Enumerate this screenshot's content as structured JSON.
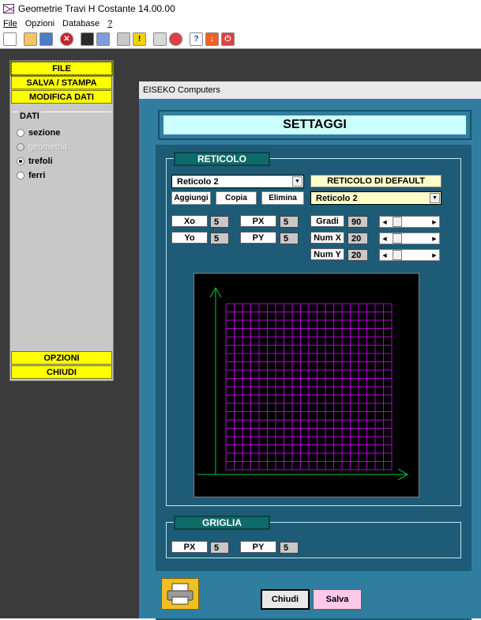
{
  "window": {
    "title": "Geometrie Travi H Costante  14.00.00"
  },
  "menubar": {
    "items": [
      "File",
      "Opzioni",
      "Database",
      "?"
    ]
  },
  "sidebar": {
    "file_btn": "FILE",
    "salva_btn": "SALVA / STAMPA",
    "modifica_btn": "MODIFICA DATI",
    "dati_label": "DATI",
    "radios": [
      {
        "label": "sezione",
        "selected": false,
        "enabled": true
      },
      {
        "label": "geometria",
        "selected": false,
        "enabled": false
      },
      {
        "label": "trefoli",
        "selected": true,
        "enabled": true
      },
      {
        "label": "ferri",
        "selected": false,
        "enabled": true
      }
    ],
    "opzioni_btn": "OPZIONI",
    "chiudi_btn": "CHIUDI"
  },
  "dialog": {
    "title": "EISEKO Computers",
    "header": "SETTAGGI",
    "reticolo": {
      "tab_label": "RETICOLO",
      "selected_reticolo": "Reticolo 2",
      "buttons": {
        "aggiungi": "Aggiungi",
        "copia": "Copia",
        "elimina": "Elimina"
      },
      "default_header": "RETICOLO DI DEFAULT",
      "default_value": "Reticolo 2",
      "xo_label": "Xo",
      "xo_value": "5",
      "yo_label": "Yo",
      "yo_value": "5",
      "px_label": "PX",
      "px_value": "5",
      "py_label": "PY",
      "py_value": "5",
      "gradi_label": "Gradi",
      "gradi_value": "90",
      "numx_label": "Num X",
      "numx_value": "20",
      "numy_label": "Num Y",
      "numy_value": "20"
    },
    "griglia": {
      "tab_label": "GRIGLIA",
      "px_label": "PX",
      "px_value": "5",
      "py_label": "PY",
      "py_value": "5"
    },
    "chiudi_btn": "Chiudi",
    "salva_btn": "Salva"
  },
  "colors": {
    "desktop": "#3b3b3b",
    "dialog": "#2f7ea0",
    "yellow_button": "#ffff00",
    "grid": "#b000d0",
    "axes": "#00cc44"
  }
}
